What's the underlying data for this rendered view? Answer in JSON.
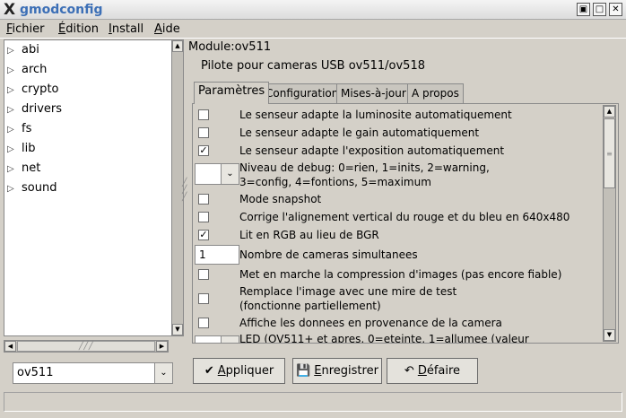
{
  "window": {
    "logo": "X",
    "title": "gmodconfig",
    "controls": [
      "▣",
      "□",
      "✕"
    ]
  },
  "menu": [
    {
      "label_u": "F",
      "label_rest": "ichier"
    },
    {
      "label_u": "É",
      "label_rest": "dition"
    },
    {
      "label_u": "I",
      "label_rest": "nstall"
    },
    {
      "label_u": "A",
      "label_rest": "ide"
    }
  ],
  "tree": [
    "abi",
    "arch",
    "crypto",
    "drivers",
    "fs",
    "lib",
    "net",
    "sound"
  ],
  "module_combo": "ov511",
  "module_header": "Module:ov511",
  "module_description": "Pilote pour cameras USB ov511/ov518",
  "tabs": [
    "Paramètres",
    "Configuration",
    "Mises-à-jour",
    "A propos"
  ],
  "params": [
    {
      "type": "checkbox",
      "checked": false,
      "label": "Le senseur adapte la luminosite automatiquement"
    },
    {
      "type": "checkbox",
      "checked": false,
      "label": "Le senseur adapte le gain automatiquement"
    },
    {
      "type": "checkbox",
      "checked": true,
      "label": "Le senseur adapte l'exposition automatiquement"
    },
    {
      "type": "combo",
      "value": "",
      "label1": "Niveau de debug: 0=rien, 1=inits, 2=warning,",
      "label2": "3=config, 4=fontions, 5=maximum"
    },
    {
      "type": "checkbox",
      "checked": false,
      "label": "Mode snapshot"
    },
    {
      "type": "checkbox",
      "checked": false,
      "label": "Corrige l'alignement vertical du rouge et du bleu en 640x480"
    },
    {
      "type": "checkbox",
      "checked": true,
      "label": "Lit en RGB au lieu de BGR"
    },
    {
      "type": "spin",
      "value": "1",
      "label": "Nombre de cameras simultanees"
    },
    {
      "type": "checkbox",
      "checked": false,
      "label": "Met en marche la compression d'images (pas encore fiable)"
    },
    {
      "type": "checkbox",
      "checked": false,
      "label1": "Remplace l'image avec une mire de test",
      "label2": "(fonctionne partiellement)"
    },
    {
      "type": "checkbox",
      "checked": false,
      "label": "Affiche les donnees en provenance de la camera"
    },
    {
      "type": "combo",
      "value": "",
      "label": "LED (OV511+ et apres, 0=eteinte, 1=allumee (valeur"
    }
  ],
  "buttons": {
    "apply": {
      "u": "A",
      "rest": "ppliquer",
      "icon": "✔"
    },
    "save": {
      "u": "E",
      "rest": "nregistrer",
      "icon": "💾"
    },
    "undo": {
      "u": "D",
      "rest": "éfaire",
      "icon": "↶"
    }
  },
  "icons": {
    "tree_expander": "▷",
    "scroll_up": "▲",
    "scroll_down": "▼",
    "scroll_left": "◀",
    "scroll_right": "▶",
    "combo_arrow": "⌄",
    "check": "✓"
  }
}
